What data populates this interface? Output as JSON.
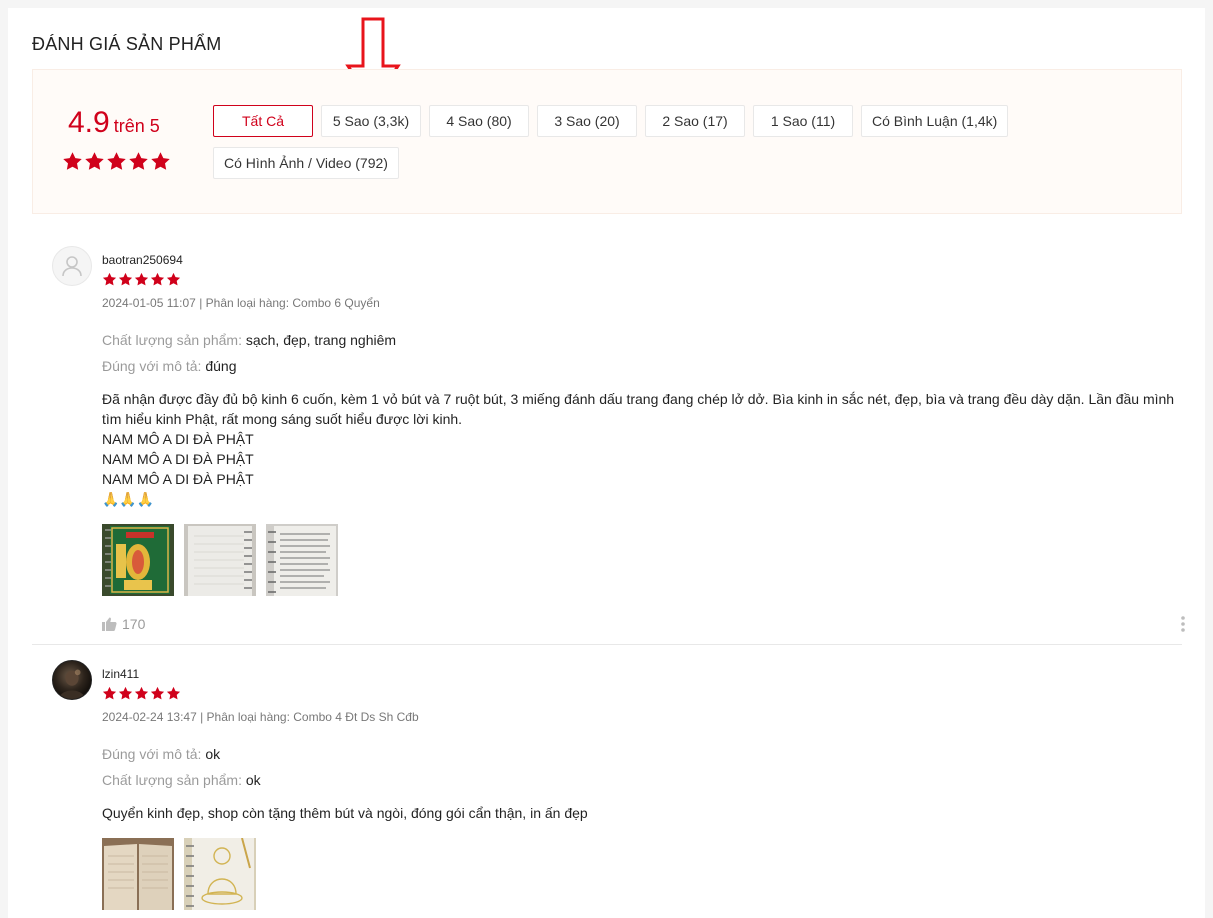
{
  "section_title": "ĐÁNH GIÁ SẢN PHẨM",
  "colors": {
    "accent": "#d0011b",
    "arrow": "#e8141b"
  },
  "overview": {
    "score": "4.9",
    "score_unit": "trên 5",
    "stars": 5,
    "filters": [
      {
        "label": "Tất Cả",
        "active": true
      },
      {
        "label": "5 Sao (3,3k)"
      },
      {
        "label": "4 Sao (80)"
      },
      {
        "label": "3 Sao (20)"
      },
      {
        "label": "2 Sao (17)"
      },
      {
        "label": "1 Sao (11)"
      },
      {
        "label": "Có Bình Luận (1,4k)"
      },
      {
        "label": "Có Hình Ảnh / Video (792)"
      }
    ]
  },
  "reviews": [
    {
      "username": "baotran250694",
      "avatar": "default-user-icon",
      "rating": 5,
      "meta": "2024-01-05 11:07 | Phân loại hàng: Combo 6 Quyển",
      "attributes": [
        {
          "label": "Chất lượng sản phẩm:",
          "value": "sạch, đẹp, trang nghiêm"
        },
        {
          "label": "Đúng với mô tả:",
          "value": "đúng"
        }
      ],
      "text_lines": [
        "Đã nhận được đầy đủ bộ kinh 6 cuốn, kèm 1 vỏ bút và 7 ruột bút, 3 miếng đánh dấu trang đang chép lở dở. Bìa kinh in sắc nét, đẹp, bìa và trang đều dày dặn. Lần đầu mình tìm hiểu kinh Phật, rất mong sáng suốt hiểu được lời kinh.",
        "NAM MÔ A DI ĐÀ PHẬT",
        "NAM MÔ A DI ĐÀ PHẬT",
        "NAM MÔ A DI ĐÀ PHẬT",
        "🙏🙏🙏"
      ],
      "images": [
        "green-sutra-cover-photo",
        "blank-lined-page-photo",
        "printed-text-page-photo"
      ],
      "likes": "170"
    },
    {
      "username": "lzin411",
      "avatar": "user-photo",
      "rating": 5,
      "meta": "2024-02-24 13:47 | Phân loại hàng: Combo 4 Đt Ds Sh Cđb",
      "attributes": [
        {
          "label": "Đúng với mô tả:",
          "value": "ok"
        },
        {
          "label": "Chất lượng sản phẩm:",
          "value": "ok"
        }
      ],
      "text_lines": [
        "Quyển kinh đẹp, shop còn tặng thêm bút và ngòi, đóng gói cẩn thận, in ấn đẹp"
      ],
      "images": [
        "open-book-photo",
        "buddha-tracing-page-photo"
      ]
    }
  ]
}
